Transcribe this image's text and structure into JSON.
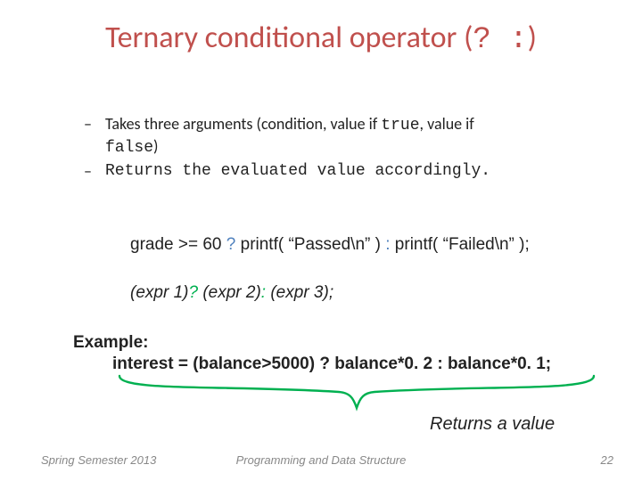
{
  "title": {
    "text": "Ternary conditional operator (",
    "op": "? :",
    "close": ")"
  },
  "bullets": {
    "b1a": "Takes three arguments (condition, value if ",
    "b1code1": "true",
    "b1b": ", value if ",
    "b1code2": "false",
    "b1c": ")",
    "b2": "Returns the evaluated value accordingly.",
    "dash": "–"
  },
  "code1": {
    "a": "grade >= 60 ",
    "q": "?",
    "b": " printf( “Passed\\n” ) ",
    "c": ":",
    "d": " printf( “Failed\\n” );"
  },
  "code2": {
    "a": "(expr 1)",
    "q": "?",
    "b": " (expr 2)",
    "c": ":",
    "d": " (expr 3);"
  },
  "example": {
    "label": "Example:",
    "line": "interest = (balance>5000) ? balance*0. 2 : balance*0. 1;"
  },
  "returns": "Returns a value",
  "footer": {
    "left": "Spring Semester 2013",
    "center": "Programming and Data Structure",
    "right": "22"
  }
}
